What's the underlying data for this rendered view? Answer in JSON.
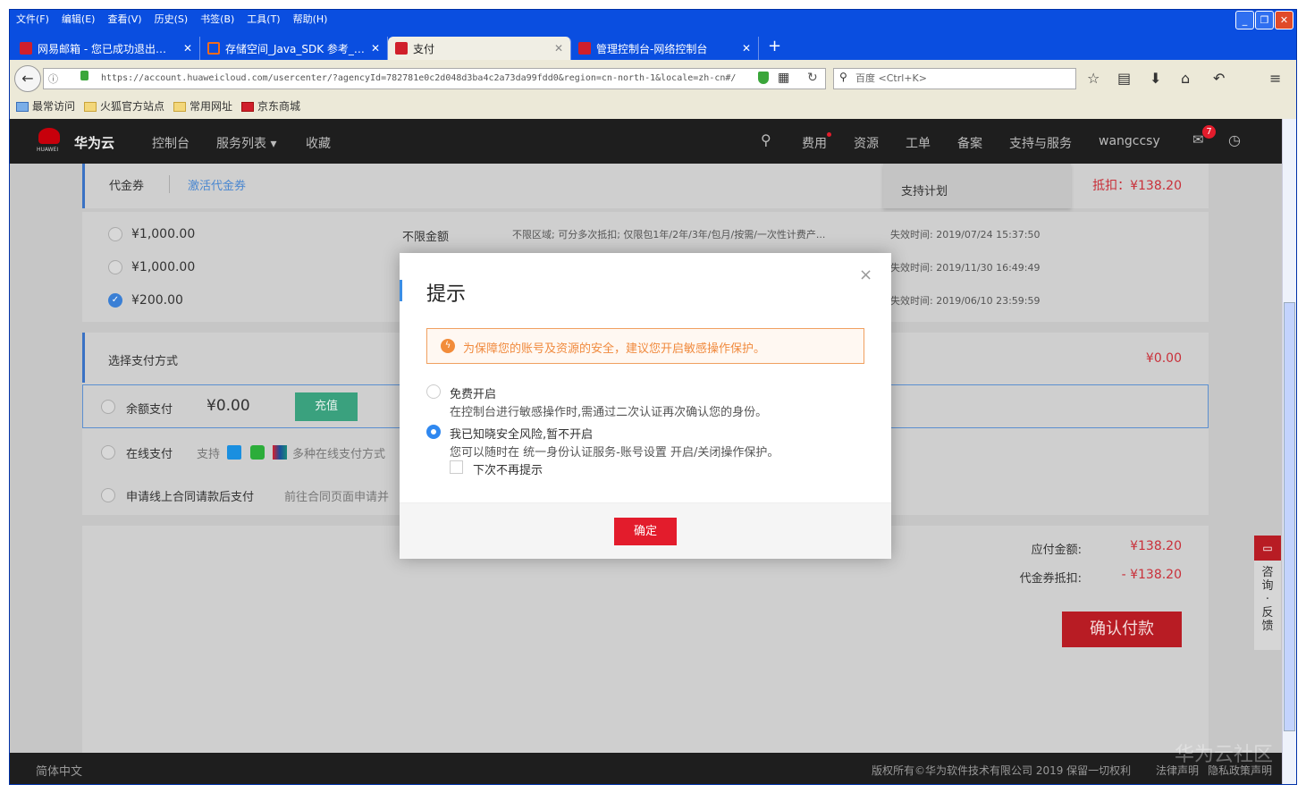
{
  "browser": {
    "menu": [
      "文件(F)",
      "编辑(E)",
      "查看(V)",
      "历史(S)",
      "书签(B)",
      "工具(T)",
      "帮助(H)"
    ],
    "tabs": [
      {
        "title": "网易邮箱 - 您已成功退出…",
        "color": "#d01f2b"
      },
      {
        "title": "存储空间_Java_SDK 参考_…",
        "color": "#f26b1d"
      },
      {
        "title": "支付",
        "color": "#d01f2b"
      },
      {
        "title": "管理控制台-网络控制台",
        "color": "#d01f2b"
      }
    ],
    "url": "https://account.huaweicloud.com/usercenter/?agencyId=782781e0c2d048d3ba4c2a73da99fdd0&region=cn-north-1&locale=zh-cn#/",
    "search_placeholder": "百度 <Ctrl+K>",
    "bookmarks": [
      "最常访问",
      "火狐官方站点",
      "常用网址",
      "京东商城"
    ]
  },
  "nav": {
    "brand": "华为云",
    "logo_text": "HUAWEI",
    "links": [
      "控制台",
      "服务列表 ▾",
      "收藏"
    ],
    "right": [
      "费用",
      "资源",
      "工单",
      "备案",
      "支持与服务"
    ],
    "user": "wangccsy",
    "msg_count": "7",
    "dropdown_item": "支持计划"
  },
  "voucher": {
    "title": "代金券",
    "activate": "激活代金券",
    "deduct": "抵扣：¥138.20",
    "rows": [
      {
        "amount": "¥1,000.00",
        "type": "不限金额",
        "desc": "不限区域; 可分多次抵扣; 仅限包1年/2年/3年/包月/按需/一次性计费产...",
        "expiry": "失效时间: 2019/07/24 15:37:50",
        "checked": false
      },
      {
        "amount": "¥1,000.00",
        "type": "",
        "desc": "",
        "expiry": "失效时间: 2019/11/30 16:49:49",
        "checked": false
      },
      {
        "amount": "¥200.00",
        "type": "",
        "desc": "",
        "expiry": "失效时间: 2019/06/10 23:59:59",
        "checked": true
      }
    ]
  },
  "payment": {
    "title": "选择支付方式",
    "amount": "¥0.00",
    "balance": {
      "label": "余额支付",
      "value": "¥0.00",
      "recharge": "充值"
    },
    "online": {
      "label": "在线支付",
      "support": "支持",
      "methods": "多种在线支付方式"
    },
    "contract": {
      "label": "申请线上合同请款后支付",
      "hint": "前往合同页面申请并"
    }
  },
  "summary": {
    "payable_label": "应付金额:",
    "payable": "¥138.20",
    "voucher_label": "代金券抵扣:",
    "voucher": "- ¥138.20",
    "confirm": "确认付款"
  },
  "feedback": [
    "咨",
    "询",
    "·",
    "反",
    "馈"
  ],
  "footer": {
    "lang": "简体中文",
    "copyright": "版权所有©华为软件技术有限公司 2019 保留一切权利",
    "legal": "法律声明",
    "privacy": "隐私政策声明",
    "watermark": "华为云社区"
  },
  "modal": {
    "title": "提示",
    "close": "×",
    "warning": "为保障您的账号及资源的安全，建议您开启敏感操作保护。",
    "options": [
      {
        "label": "免费开启",
        "desc": "在控制台进行敏感操作时,需通过二次认证再次确认您的身份。",
        "selected": false
      },
      {
        "label": "我已知晓安全风险,暂不开启",
        "desc": "您可以随时在 统一身份认证服务-账号设置 开启/关闭操作保护。",
        "selected": true
      }
    ],
    "dont_remind": "下次不再提示",
    "ok": "确定"
  }
}
